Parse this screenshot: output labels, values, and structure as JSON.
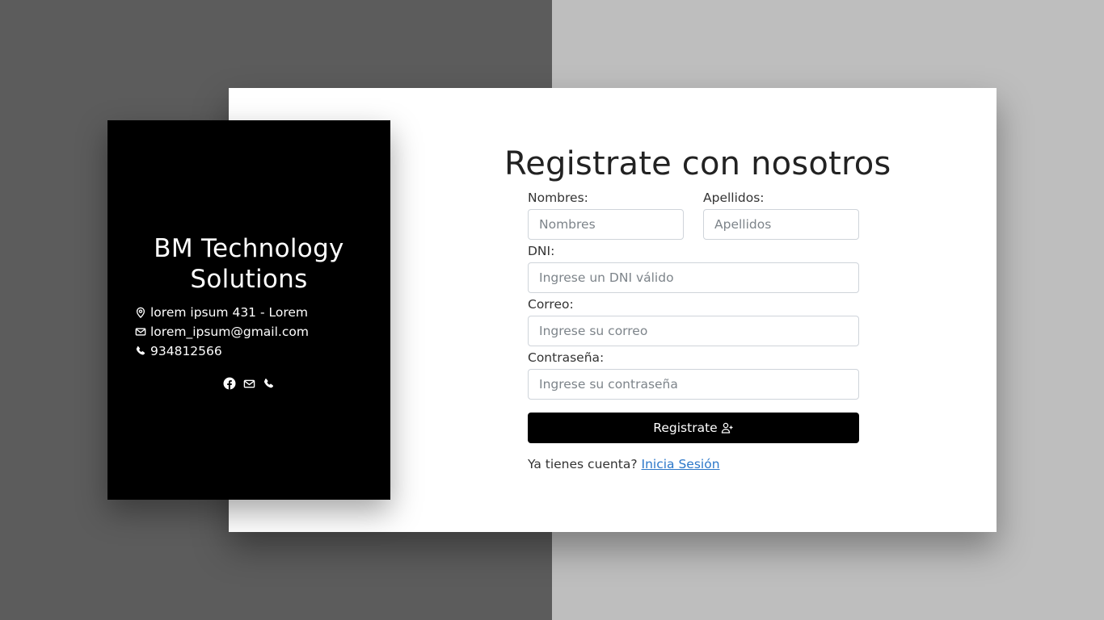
{
  "brand": {
    "name_line1": "BM Technology",
    "name_line2": "Solutions",
    "address": "lorem ipsum 431 - Lorem",
    "email": "lorem_ipsum@gmail.com",
    "phone": "934812566"
  },
  "form": {
    "title": "Registrate con nosotros",
    "nombres_label": "Nombres:",
    "nombres_placeholder": "Nombres",
    "apellidos_label": "Apellidos:",
    "apellidos_placeholder": "Apellidos",
    "dni_label": "DNI:",
    "dni_placeholder": "Ingrese un DNI válido",
    "correo_label": "Correo:",
    "correo_placeholder": "Ingrese su correo",
    "password_label": "Contraseña:",
    "password_placeholder": "Ingrese su contraseña",
    "submit_label": "Registrate",
    "login_prompt": "Ya tienes cuenta?",
    "login_link": "Inicia Sesión"
  },
  "colors": {
    "background_left": "#5c5c5c",
    "background_right": "#bebebe",
    "info_panel": "#000000",
    "button": "#000000",
    "link": "#2b77c9"
  },
  "icons": {
    "address": "map-pin-icon",
    "email": "envelope-icon",
    "phone": "phone-icon",
    "social": [
      "facebook-icon",
      "envelope-icon",
      "phone-icon"
    ],
    "submit": "person-plus-icon"
  }
}
